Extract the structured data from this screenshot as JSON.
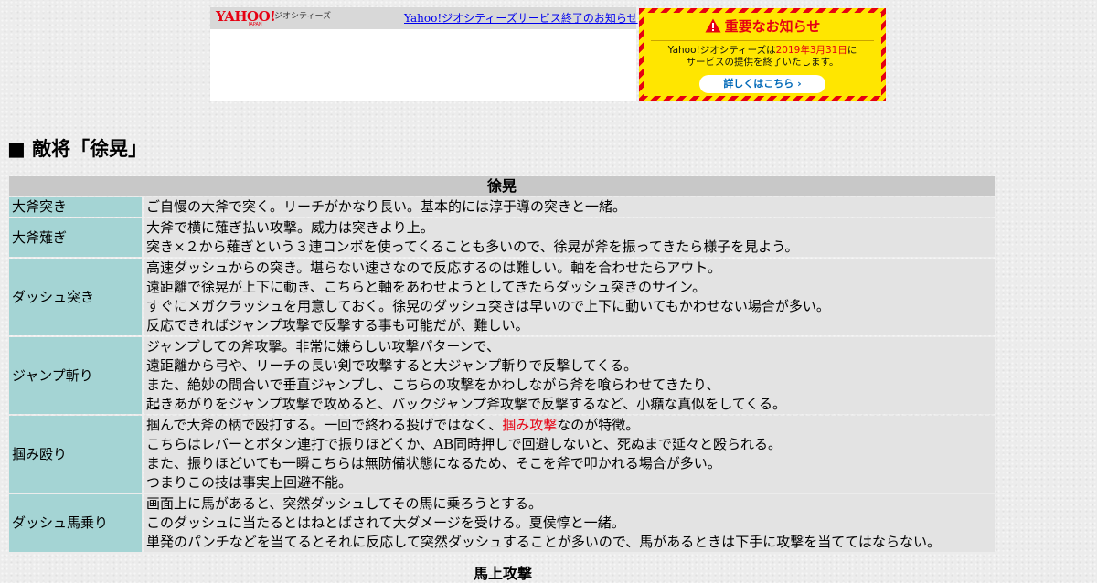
{
  "banner": {
    "logo_text": "YAHOO!",
    "logo_sub": "JAPAN",
    "service_name": "ジオシティーズ",
    "end_link": "Yahoo!ジオシティーズサービス終了のお知らせ",
    "notice": {
      "title": "重要なお知らせ",
      "body_1_a": "Yahoo!ジオシティーズは",
      "body_1_date": "2019年3月31日",
      "body_1_b": "に",
      "body_2": "サービスの提供を終了いたします。",
      "button": "詳しくはこちら ›"
    }
  },
  "page": {
    "heading": "■ 敵将「徐晃」"
  },
  "table": {
    "header": "徐晃",
    "rows": [
      {
        "move": "大斧突き",
        "lines": [
          "ご自慢の大斧で突く。リーチがかなり長い。基本的には淳于導の突きと一緒。"
        ]
      },
      {
        "move": "大斧薙ぎ",
        "lines": [
          "大斧で横に薙ぎ払い攻撃。威力は突きより上。",
          "突き×２から薙ぎという３連コンボを使ってくることも多いので、徐晃が斧を振ってきたら様子を見よう。"
        ]
      },
      {
        "move": "ダッシュ突き",
        "lines": [
          "高速ダッシュからの突き。堪らない速さなので反応するのは難しい。軸を合わせたらアウト。",
          "遠距離で徐晃が上下に動き、こちらと軸をあわせようとしてきたらダッシュ突きのサイン。",
          "すぐにメガクラッシュを用意しておく。徐晃のダッシュ突きは早いので上下に動いてもかわせない場合が多い。",
          "反応できればジャンプ攻撃で反撃する事も可能だが、難しい。"
        ]
      },
      {
        "move": "ジャンプ斬り",
        "lines": [
          "ジャンプしての斧攻撃。非常に嫌らしい攻撃パターンで、",
          "遠距離から弓や、リーチの長い剣で攻撃すると大ジャンプ斬りで反撃してくる。",
          "また、絶妙の間合いで垂直ジャンプし、こちらの攻撃をかわしながら斧を喰らわせてきたり、",
          "起きあがりをジャンプ攻撃で攻めると、バックジャンプ斧攻撃で反撃するなど、小癪な真似をしてくる。"
        ]
      },
      {
        "move": "掴み殴り",
        "line1_a": "掴んで大斧の柄で殴打する。一回で終わる投げではなく、",
        "line1_hl": "掴み攻撃",
        "line1_b": "なのが特徴。",
        "lines": [
          "こちらはレバーとボタン連打で振りほどくか、AB同時押しで回避しないと、死ぬまで延々と殴られる。",
          "また、振りほどいても一瞬こちらは無防備状態になるため、そこを斧で叩かれる場合が多い。",
          "つまりこの技は事実上回避不能。"
        ]
      },
      {
        "move": "ダッシュ馬乗り",
        "lines": [
          "画面上に馬があると、突然ダッシュしてその馬に乗ろうとする。",
          "このダッシュに当たるとはねとばされて大ダメージを受ける。夏侯惇と一緒。",
          "単発のパンチなどを当てるとそれに反応して突然ダッシュすることが多いので、馬があるときは下手に攻撃を当ててはならない。"
        ]
      }
    ],
    "next_section": "馬上攻撃"
  },
  "colors": {
    "move_cell": "#a4d4d4",
    "desc_cell": "#e3e3e3",
    "header_cell": "#c8c8c8",
    "highlight": "#e60012",
    "notice_yellow": "#ffe600",
    "link": "#0000ee"
  }
}
